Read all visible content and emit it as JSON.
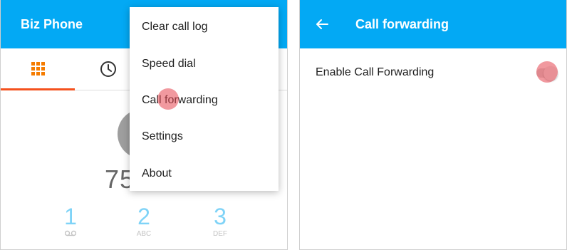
{
  "left_screen": {
    "app_title": "Biz Phone",
    "tabs": [
      {
        "icon": "dialpad-icon",
        "selected": true
      },
      {
        "icon": "clock-icon",
        "selected": false
      }
    ],
    "dialed_number_partial": "75",
    "keypad": [
      {
        "digit": "1",
        "letters": "",
        "icon": "voicemail-icon"
      },
      {
        "digit": "2",
        "letters": "ABC"
      },
      {
        "digit": "3",
        "letters": "DEF"
      }
    ],
    "overflow_menu": {
      "items": [
        {
          "label": "Clear call log"
        },
        {
          "label": "Speed dial"
        },
        {
          "label": "Call forwarding"
        },
        {
          "label": "Settings"
        },
        {
          "label": "About"
        }
      ]
    }
  },
  "right_screen": {
    "title": "Call forwarding",
    "back_icon": "arrow-left-icon",
    "setting": {
      "label": "Enable Call Forwarding",
      "enabled": false
    }
  },
  "colors": {
    "appbar": "#03a9f4",
    "tab_indicator": "#f4511e",
    "dialpad_icon": "#f57c00",
    "touch_indicator": "#e64650"
  }
}
